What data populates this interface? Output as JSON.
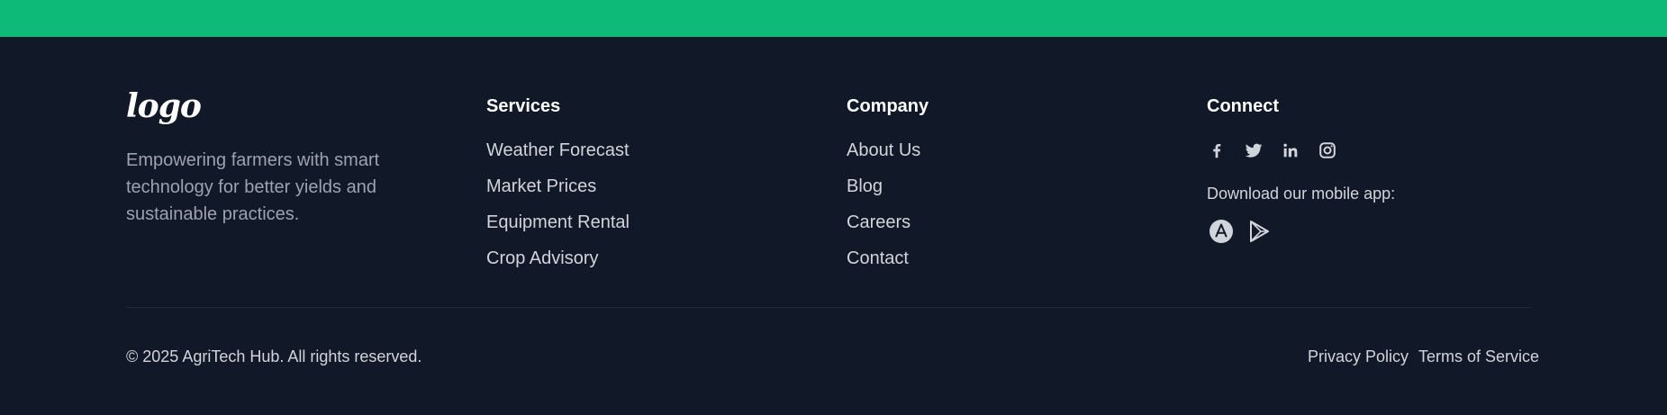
{
  "brand": {
    "logo_text": "logo",
    "tagline": "Empowering farmers with smart technology for better yields and sustainable practices."
  },
  "services": {
    "heading": "Services",
    "links": [
      "Weather Forecast",
      "Market Prices",
      "Equipment Rental",
      "Crop Advisory"
    ]
  },
  "company": {
    "heading": "Company",
    "links": [
      "About Us",
      "Blog",
      "Careers",
      "Contact"
    ]
  },
  "connect": {
    "heading": "Connect",
    "social_icons": [
      "facebook-icon",
      "twitter-icon",
      "linkedin-icon",
      "instagram-icon"
    ],
    "app_label": "Download our mobile app:",
    "store_icons": [
      "app-store-icon",
      "google-play-icon"
    ]
  },
  "bottom": {
    "copyright": "© 2025 AgriTech Hub. All rights reserved.",
    "privacy": "Privacy Policy",
    "terms": "Terms of Service"
  },
  "colors": {
    "accent_bar": "#0eba78",
    "background": "#111827",
    "text_muted": "#9ca3af",
    "text_link": "#d1d5db"
  }
}
